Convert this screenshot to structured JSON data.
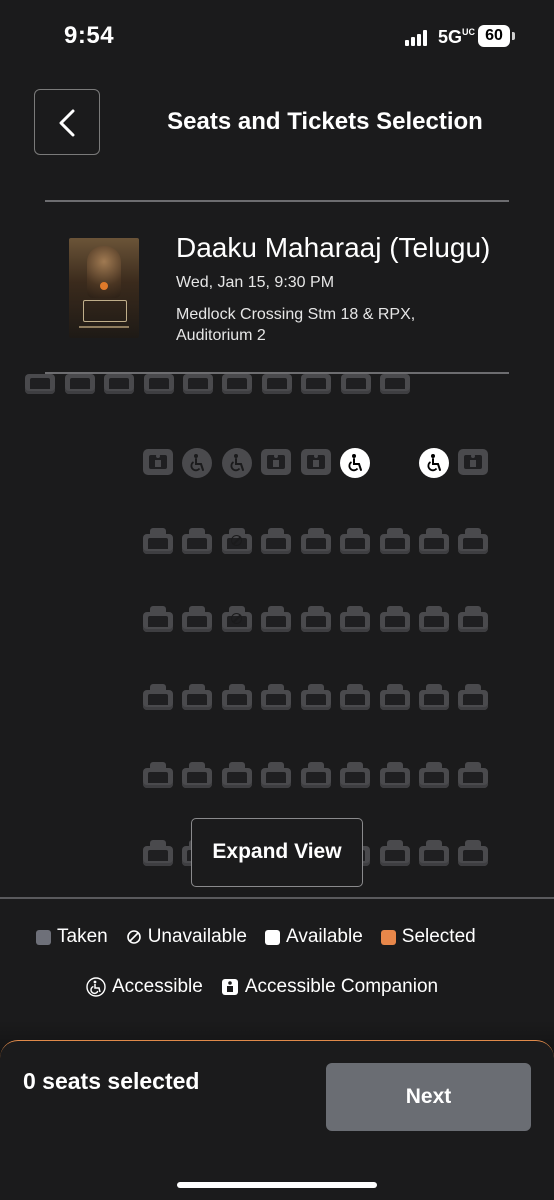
{
  "status_bar": {
    "time": "9:54",
    "network": "5G",
    "network_sup": "UC",
    "battery": "60"
  },
  "header": {
    "title": "Seats and Tickets Selection"
  },
  "movie": {
    "title": "Daaku Maharaaj (Telugu)",
    "showtime": "Wed, Jan 15, 9:30 PM",
    "venue": "Medlock Crossing Stm 18 & RPX, Auditorium 2"
  },
  "seat_map": {
    "expand_label": "Expand View"
  },
  "legend": {
    "taken": "Taken",
    "unavailable": "Unavailable",
    "available": "Available",
    "selected": "Selected",
    "accessible": "Accessible",
    "accessible_companion": "Accessible Companion",
    "colors": {
      "taken": "#6e7079",
      "available": "#ffffff",
      "selected": "#e8874a"
    }
  },
  "footer": {
    "seats_selected": "0 seats selected",
    "next_label": "Next"
  },
  "colors": {
    "background": "#1b1b1c",
    "seat": "#4a4a4d",
    "button_disabled": "#6a6d73",
    "accent": "#e08a4a"
  }
}
